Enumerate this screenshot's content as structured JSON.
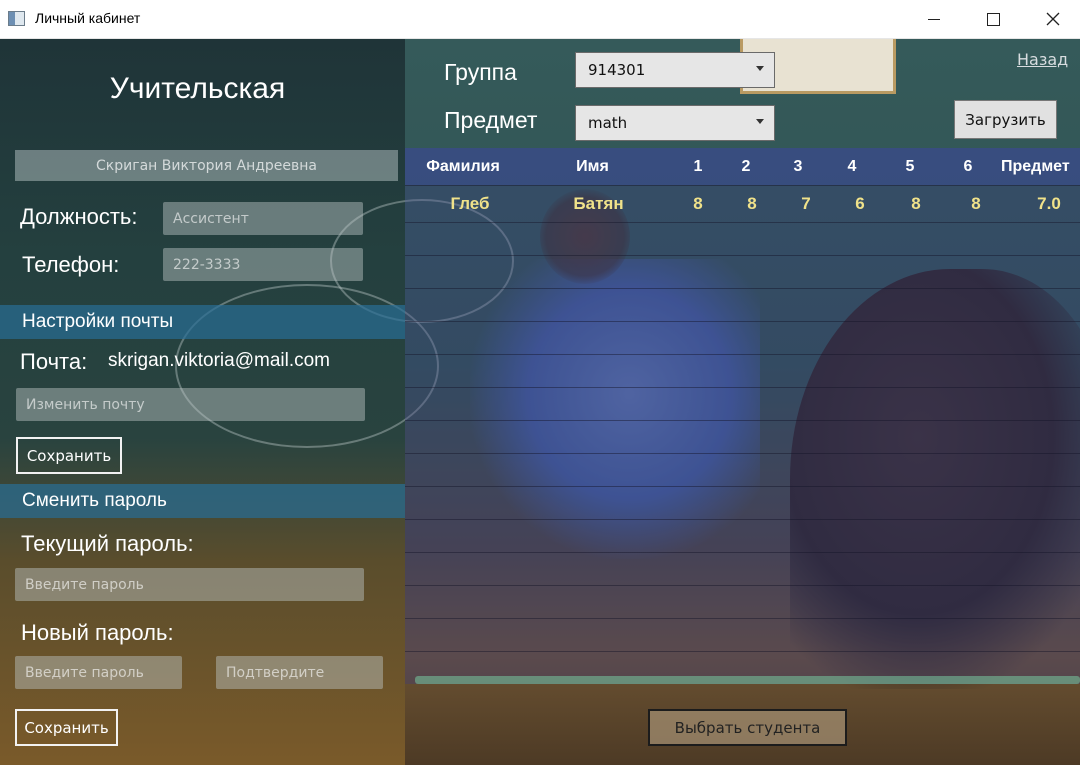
{
  "window": {
    "title": "Личный кабинет"
  },
  "left": {
    "heading": "Учительская",
    "full_name": "Скриган Виктория Андреевна",
    "position_label": "Должность:",
    "position_value": "Ассистент",
    "phone_label": "Телефон:",
    "phone_value": "222-3333",
    "mail_section": "Настройки почты",
    "mail_label": "Почта:",
    "mail_value": "skrigan.viktoria@mail.com",
    "mail_placeholder": "Изменить почту",
    "save_mail_label": "Сохранить",
    "password_section": "Сменить пароль",
    "current_password_label": "Текущий пароль:",
    "current_password_placeholder": "Введите пароль",
    "new_password_label": "Новый пароль:",
    "new_password_placeholder": "Введите пароль",
    "confirm_placeholder": "Подтвердите",
    "save_password_label": "Сохранить"
  },
  "right": {
    "back_link": "Назад",
    "group_label": "Группа",
    "group_value": "914301",
    "subject_label": "Предмет",
    "subject_value": "math",
    "load_button": "Загрузить",
    "columns": [
      "Фамилия",
      "Имя",
      "1",
      "2",
      "3",
      "4",
      "5",
      "6",
      "Предмет"
    ],
    "rows": [
      [
        "Глеб",
        "Батян",
        "8",
        "8",
        "7",
        "6",
        "8",
        "8",
        "7.0"
      ]
    ],
    "select_student_button": "Выбрать студента"
  }
}
